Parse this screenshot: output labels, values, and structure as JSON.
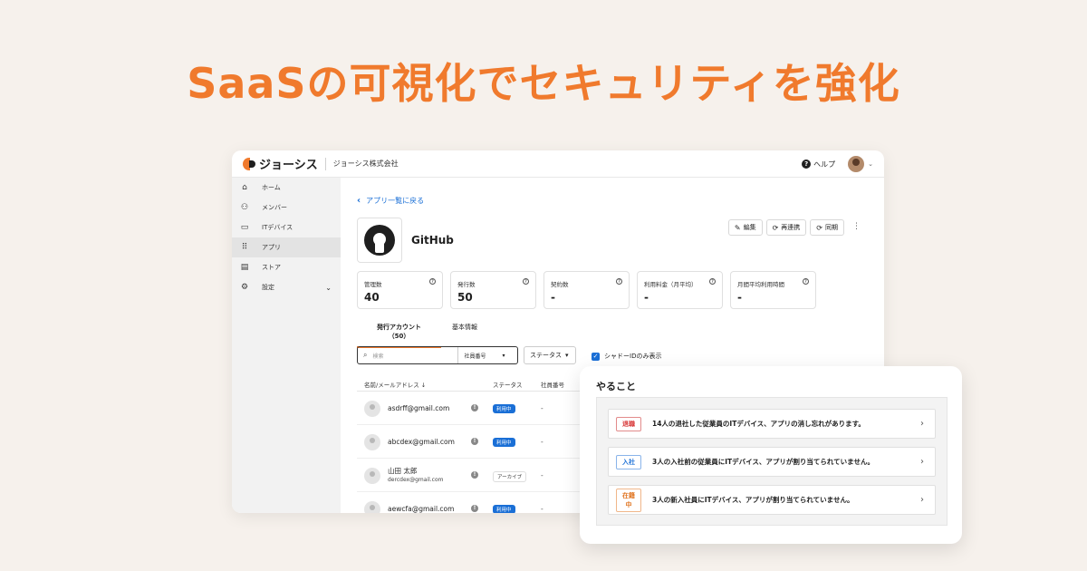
{
  "headline": "SaaSの可視化でセキュリティを強化",
  "topbar": {
    "logo_text": "ジョーシス",
    "company": "ジョーシス株式会社",
    "help": "ヘルプ"
  },
  "sidebar": {
    "items": [
      {
        "label": "ホーム",
        "icon": "home-icon"
      },
      {
        "label": "メンバー",
        "icon": "people-icon"
      },
      {
        "label": "ITデバイス",
        "icon": "laptop-icon"
      },
      {
        "label": "アプリ",
        "icon": "grid-icon"
      },
      {
        "label": "ストア",
        "icon": "store-icon"
      },
      {
        "label": "設定",
        "icon": "gear-icon"
      }
    ]
  },
  "main": {
    "back_label": "アプリ一覧に戻る",
    "app_name": "GitHub",
    "actions": {
      "edit": "編集",
      "relink": "再連携",
      "sync": "同期"
    },
    "stats": [
      {
        "label": "管理数",
        "value": "40"
      },
      {
        "label": "発行数",
        "value": "50"
      },
      {
        "label": "契約数",
        "value": "-"
      },
      {
        "label": "利用料金（月平均）",
        "value": "-"
      },
      {
        "label": "月間平均利用時間",
        "value": "-"
      }
    ],
    "tabs": {
      "accounts": "発行アカウント（50）",
      "info": "基本情報"
    },
    "search": {
      "placeholder": "検索",
      "field": "社員番号"
    },
    "status_filter": "ステータス",
    "shadow_only": "シャドーIDのみ表示",
    "table": {
      "headers": {
        "name": "名前/メールアドレス ↓",
        "status": "ステータス",
        "emp_no": "社員番号"
      },
      "rows": [
        {
          "email": "asdrff@gmail.com",
          "status": "利用中",
          "emp": "-"
        },
        {
          "email": "abcdex@gmail.com",
          "status": "利用中",
          "emp": "-"
        },
        {
          "name": "山田 太郎",
          "email": "dercdex@gmail.com",
          "status": "アーカイブ",
          "emp": "-"
        },
        {
          "email": "aewcfa@gmail.com",
          "status": "利用中",
          "emp": "-"
        }
      ]
    }
  },
  "todo_card": {
    "title": "やること",
    "items": [
      {
        "tag": "退職",
        "text": "14人の退社した従業員のITデバイス、アプリの消し忘れがあります。"
      },
      {
        "tag": "入社",
        "text": "3人の入社前の従業員にITデバイス、アプリが割り当てられていません。"
      },
      {
        "tag": "在籍中",
        "text": "3人の新入社員にITデバイス、アプリが割り当てられていません。"
      }
    ]
  }
}
